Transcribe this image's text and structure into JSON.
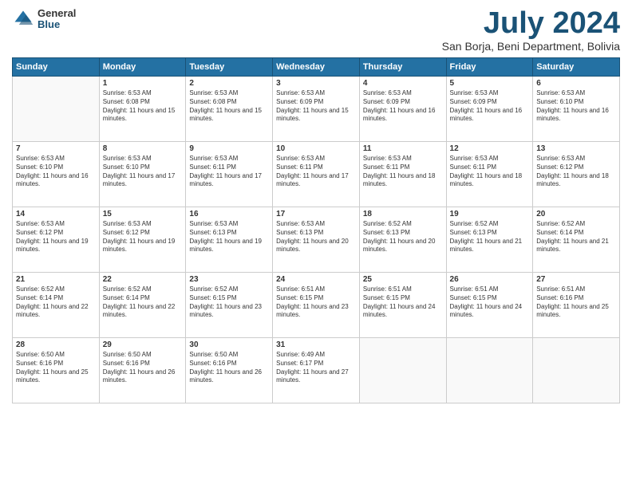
{
  "logo": {
    "general": "General",
    "blue": "Blue"
  },
  "header": {
    "month": "July 2024",
    "location": "San Borja, Beni Department, Bolivia"
  },
  "weekdays": [
    "Sunday",
    "Monday",
    "Tuesday",
    "Wednesday",
    "Thursday",
    "Friday",
    "Saturday"
  ],
  "weeks": [
    [
      {
        "day": "",
        "sunrise": "",
        "sunset": "",
        "daylight": ""
      },
      {
        "day": "1",
        "sunrise": "Sunrise: 6:53 AM",
        "sunset": "Sunset: 6:08 PM",
        "daylight": "Daylight: 11 hours and 15 minutes."
      },
      {
        "day": "2",
        "sunrise": "Sunrise: 6:53 AM",
        "sunset": "Sunset: 6:08 PM",
        "daylight": "Daylight: 11 hours and 15 minutes."
      },
      {
        "day": "3",
        "sunrise": "Sunrise: 6:53 AM",
        "sunset": "Sunset: 6:09 PM",
        "daylight": "Daylight: 11 hours and 15 minutes."
      },
      {
        "day": "4",
        "sunrise": "Sunrise: 6:53 AM",
        "sunset": "Sunset: 6:09 PM",
        "daylight": "Daylight: 11 hours and 16 minutes."
      },
      {
        "day": "5",
        "sunrise": "Sunrise: 6:53 AM",
        "sunset": "Sunset: 6:09 PM",
        "daylight": "Daylight: 11 hours and 16 minutes."
      },
      {
        "day": "6",
        "sunrise": "Sunrise: 6:53 AM",
        "sunset": "Sunset: 6:10 PM",
        "daylight": "Daylight: 11 hours and 16 minutes."
      }
    ],
    [
      {
        "day": "7",
        "sunrise": "Sunrise: 6:53 AM",
        "sunset": "Sunset: 6:10 PM",
        "daylight": "Daylight: 11 hours and 16 minutes."
      },
      {
        "day": "8",
        "sunrise": "Sunrise: 6:53 AM",
        "sunset": "Sunset: 6:10 PM",
        "daylight": "Daylight: 11 hours and 17 minutes."
      },
      {
        "day": "9",
        "sunrise": "Sunrise: 6:53 AM",
        "sunset": "Sunset: 6:11 PM",
        "daylight": "Daylight: 11 hours and 17 minutes."
      },
      {
        "day": "10",
        "sunrise": "Sunrise: 6:53 AM",
        "sunset": "Sunset: 6:11 PM",
        "daylight": "Daylight: 11 hours and 17 minutes."
      },
      {
        "day": "11",
        "sunrise": "Sunrise: 6:53 AM",
        "sunset": "Sunset: 6:11 PM",
        "daylight": "Daylight: 11 hours and 18 minutes."
      },
      {
        "day": "12",
        "sunrise": "Sunrise: 6:53 AM",
        "sunset": "Sunset: 6:11 PM",
        "daylight": "Daylight: 11 hours and 18 minutes."
      },
      {
        "day": "13",
        "sunrise": "Sunrise: 6:53 AM",
        "sunset": "Sunset: 6:12 PM",
        "daylight": "Daylight: 11 hours and 18 minutes."
      }
    ],
    [
      {
        "day": "14",
        "sunrise": "Sunrise: 6:53 AM",
        "sunset": "Sunset: 6:12 PM",
        "daylight": "Daylight: 11 hours and 19 minutes."
      },
      {
        "day": "15",
        "sunrise": "Sunrise: 6:53 AM",
        "sunset": "Sunset: 6:12 PM",
        "daylight": "Daylight: 11 hours and 19 minutes."
      },
      {
        "day": "16",
        "sunrise": "Sunrise: 6:53 AM",
        "sunset": "Sunset: 6:13 PM",
        "daylight": "Daylight: 11 hours and 19 minutes."
      },
      {
        "day": "17",
        "sunrise": "Sunrise: 6:53 AM",
        "sunset": "Sunset: 6:13 PM",
        "daylight": "Daylight: 11 hours and 20 minutes."
      },
      {
        "day": "18",
        "sunrise": "Sunrise: 6:52 AM",
        "sunset": "Sunset: 6:13 PM",
        "daylight": "Daylight: 11 hours and 20 minutes."
      },
      {
        "day": "19",
        "sunrise": "Sunrise: 6:52 AM",
        "sunset": "Sunset: 6:13 PM",
        "daylight": "Daylight: 11 hours and 21 minutes."
      },
      {
        "day": "20",
        "sunrise": "Sunrise: 6:52 AM",
        "sunset": "Sunset: 6:14 PM",
        "daylight": "Daylight: 11 hours and 21 minutes."
      }
    ],
    [
      {
        "day": "21",
        "sunrise": "Sunrise: 6:52 AM",
        "sunset": "Sunset: 6:14 PM",
        "daylight": "Daylight: 11 hours and 22 minutes."
      },
      {
        "day": "22",
        "sunrise": "Sunrise: 6:52 AM",
        "sunset": "Sunset: 6:14 PM",
        "daylight": "Daylight: 11 hours and 22 minutes."
      },
      {
        "day": "23",
        "sunrise": "Sunrise: 6:52 AM",
        "sunset": "Sunset: 6:15 PM",
        "daylight": "Daylight: 11 hours and 23 minutes."
      },
      {
        "day": "24",
        "sunrise": "Sunrise: 6:51 AM",
        "sunset": "Sunset: 6:15 PM",
        "daylight": "Daylight: 11 hours and 23 minutes."
      },
      {
        "day": "25",
        "sunrise": "Sunrise: 6:51 AM",
        "sunset": "Sunset: 6:15 PM",
        "daylight": "Daylight: 11 hours and 24 minutes."
      },
      {
        "day": "26",
        "sunrise": "Sunrise: 6:51 AM",
        "sunset": "Sunset: 6:15 PM",
        "daylight": "Daylight: 11 hours and 24 minutes."
      },
      {
        "day": "27",
        "sunrise": "Sunrise: 6:51 AM",
        "sunset": "Sunset: 6:16 PM",
        "daylight": "Daylight: 11 hours and 25 minutes."
      }
    ],
    [
      {
        "day": "28",
        "sunrise": "Sunrise: 6:50 AM",
        "sunset": "Sunset: 6:16 PM",
        "daylight": "Daylight: 11 hours and 25 minutes."
      },
      {
        "day": "29",
        "sunrise": "Sunrise: 6:50 AM",
        "sunset": "Sunset: 6:16 PM",
        "daylight": "Daylight: 11 hours and 26 minutes."
      },
      {
        "day": "30",
        "sunrise": "Sunrise: 6:50 AM",
        "sunset": "Sunset: 6:16 PM",
        "daylight": "Daylight: 11 hours and 26 minutes."
      },
      {
        "day": "31",
        "sunrise": "Sunrise: 6:49 AM",
        "sunset": "Sunset: 6:17 PM",
        "daylight": "Daylight: 11 hours and 27 minutes."
      },
      {
        "day": "",
        "sunrise": "",
        "sunset": "",
        "daylight": ""
      },
      {
        "day": "",
        "sunrise": "",
        "sunset": "",
        "daylight": ""
      },
      {
        "day": "",
        "sunrise": "",
        "sunset": "",
        "daylight": ""
      }
    ]
  ]
}
